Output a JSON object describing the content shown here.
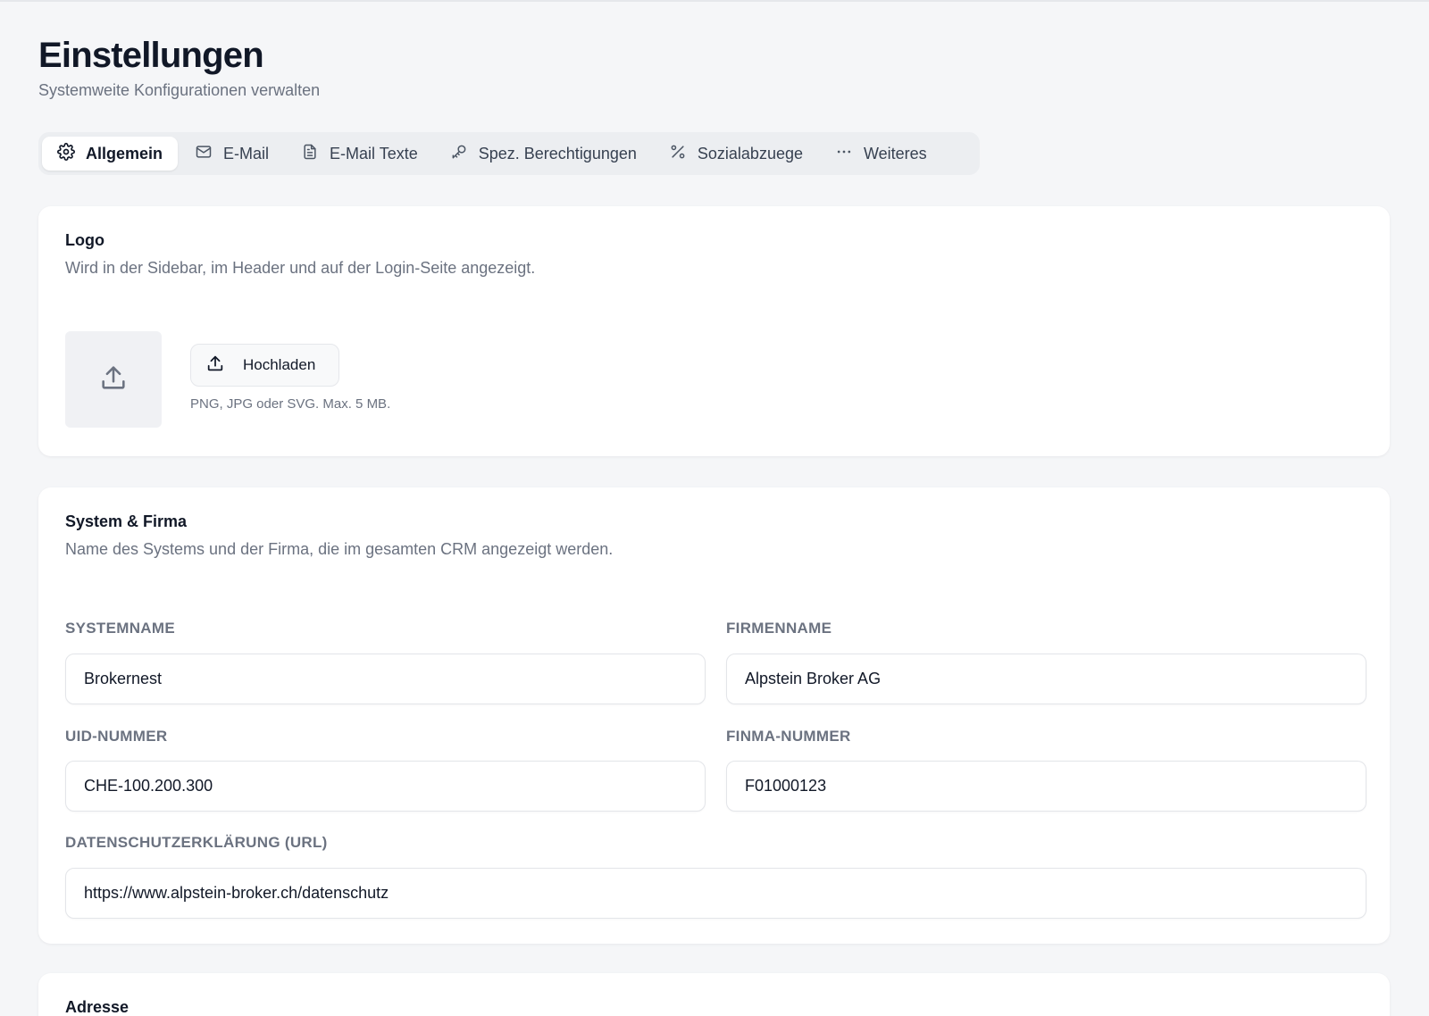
{
  "header": {
    "title": "Einstellungen",
    "subtitle": "Systemweite Konfigurationen verwalten"
  },
  "tabs": [
    {
      "label": "Allgemein",
      "icon": "gear-icon",
      "active": true
    },
    {
      "label": "E-Mail",
      "icon": "mail-icon",
      "active": false
    },
    {
      "label": "E-Mail Texte",
      "icon": "document-icon",
      "active": false
    },
    {
      "label": "Spez. Berechtigungen",
      "icon": "key-icon",
      "active": false
    },
    {
      "label": "Sozialabzuege",
      "icon": "percent-icon",
      "active": false
    },
    {
      "label": "Weiteres",
      "icon": "ellipsis-icon",
      "active": false
    }
  ],
  "logo_section": {
    "title": "Logo",
    "description": "Wird in der Sidebar, im Header und auf der Login-Seite angezeigt.",
    "upload_label": "Hochladen",
    "hint": "PNG, JPG oder SVG. Max. 5 MB."
  },
  "system_section": {
    "title": "System & Firma",
    "description": "Name des Systems und der Firma, die im gesamten CRM angezeigt werden.",
    "fields": {
      "systemname": {
        "label": "SYSTEMNAME",
        "value": "Brokernest"
      },
      "firmenname": {
        "label": "FIRMENNAME",
        "value": "Alpstein Broker AG"
      },
      "uid": {
        "label": "UID-NUMMER",
        "value": "CHE-100.200.300"
      },
      "finma": {
        "label": "FINMA-NUMMER",
        "value": "F01000123"
      },
      "privacy": {
        "label": "DATENSCHUTZERKLÄRUNG (URL)",
        "value": "https://www.alpstein-broker.ch/datenschutz"
      }
    }
  },
  "address_section": {
    "title": "Adresse"
  },
  "colors": {
    "background": "#f5f6f8",
    "card": "#ffffff",
    "muted_text": "#6b7280",
    "tab_bar": "#eceef1"
  }
}
